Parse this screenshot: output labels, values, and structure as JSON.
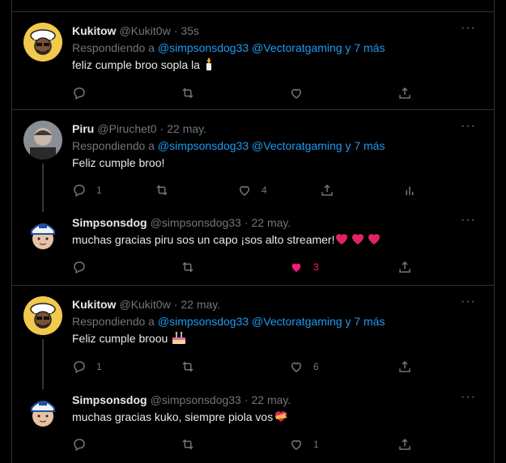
{
  "tweets": [
    {
      "name": "Kukitow",
      "handle": "@Kukit0w",
      "time": "35s",
      "replying_prefix": "Respondiendo a",
      "mention1": "@simpsonsdog33",
      "mention2": "@Vectoratgaming",
      "more_text": "y 7 más",
      "text": "feliz cumple broo sopla la",
      "emoji": "candle",
      "counts": {
        "reply": "",
        "retweet": "",
        "like": ""
      },
      "liked": false
    },
    {
      "name": "Piru",
      "handle": "@Piruchet0",
      "time": "22 may.",
      "replying_prefix": "Respondiendo a",
      "mention1": "@simpsonsdog33",
      "mention2": "@Vectoratgaming",
      "more_text": "y 7 más",
      "text": "Feliz cumple broo!",
      "counts": {
        "reply": "1",
        "retweet": "",
        "like": "4"
      },
      "liked": false
    },
    {
      "name": "Simpsonsdog",
      "handle": "@simpsonsdog33",
      "time": "22 may.",
      "text": "muchas gracias piru sos un capo ¡sos alto streamer!",
      "emoji": "three-red-hearts",
      "counts": {
        "reply": "",
        "retweet": "",
        "like": "3"
      },
      "liked": true,
      "like_color": "#f91880"
    },
    {
      "name": "Kukitow",
      "handle": "@Kukit0w",
      "time": "22 may.",
      "replying_prefix": "Respondiendo a",
      "mention1": "@simpsonsdog33",
      "mention2": "@Vectoratgaming",
      "more_text": "y 7 más",
      "text": "Feliz cumple broou",
      "emoji": "birthday-cake",
      "counts": {
        "reply": "1",
        "retweet": "",
        "like": "6"
      },
      "liked": false
    },
    {
      "name": "Simpsonsdog",
      "handle": "@simpsonsdog33",
      "time": "22 may.",
      "text": "muchas gracias kuko, siempre piola vos",
      "emoji": "heart-with-ribbon",
      "counts": {
        "reply": "",
        "retweet": "",
        "like": "1"
      },
      "liked": false
    }
  ],
  "colors": {
    "accent": "#1d9bf0",
    "muted": "#71767b",
    "text": "#e7e9ea",
    "border": "#2f3336",
    "like": "#f91880"
  },
  "dots": "···"
}
